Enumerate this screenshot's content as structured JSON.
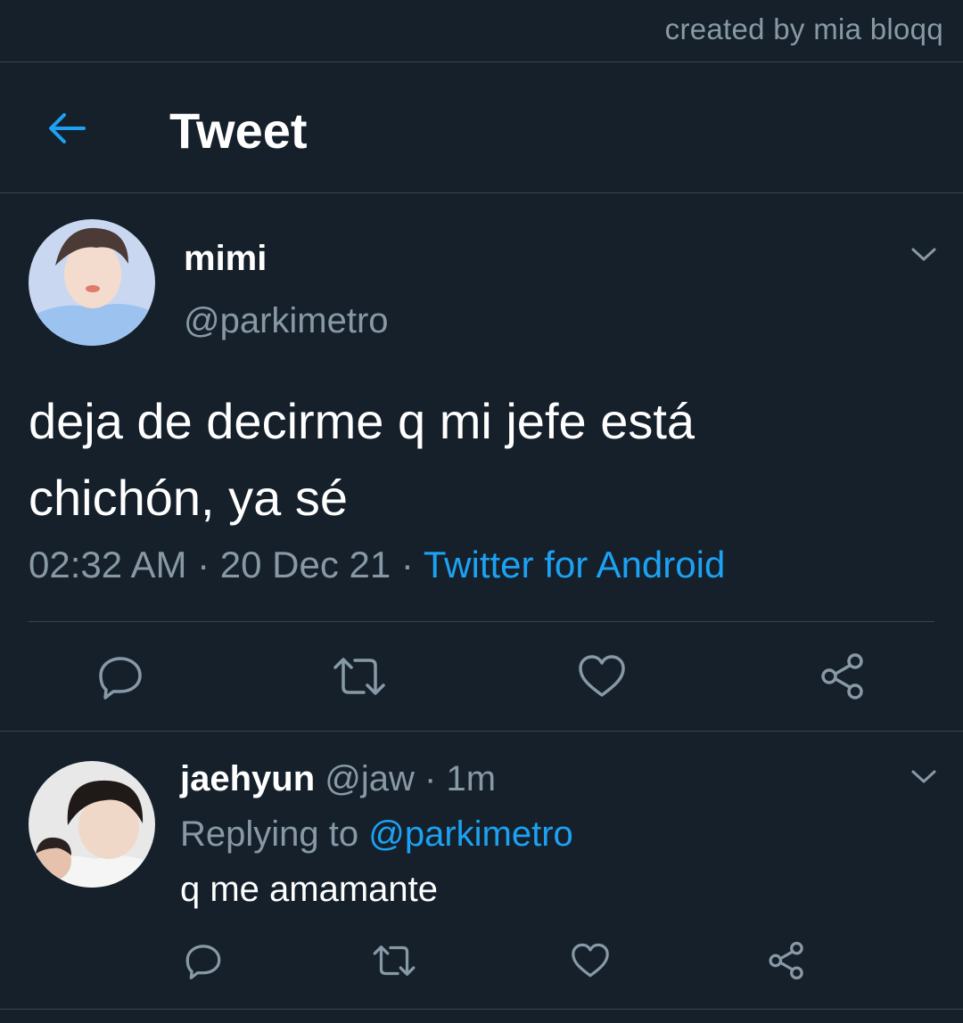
{
  "watermark": "created by mia bloqq",
  "header": {
    "title": "Tweet",
    "back_icon": "arrow-left-icon"
  },
  "tweet": {
    "display_name": "mimi",
    "handle": "@parkimetro",
    "text_line1": "deja de decirme q mi jefe está",
    "text_line2": "chichón, ya sé",
    "time": "02:32 AM",
    "date": "20 Dec 21",
    "separator": " · ",
    "source": "Twitter for Android",
    "actions": [
      "reply-icon",
      "retweet-icon",
      "like-icon",
      "share-icon"
    ]
  },
  "reply": {
    "display_name": "jaehyun",
    "handle": "@jaw",
    "separator": " · ",
    "time": "1m",
    "replying_to_label": "Replying to ",
    "replying_to_handle": "@parkimetro",
    "text": "q me amamante",
    "actions": [
      "reply-icon",
      "retweet-icon",
      "like-icon",
      "share-icon"
    ]
  },
  "colors": {
    "background": "#15202b",
    "divider": "#38444d",
    "muted": "#8899a6",
    "accent": "#1da1f2",
    "text": "#ffffff"
  }
}
